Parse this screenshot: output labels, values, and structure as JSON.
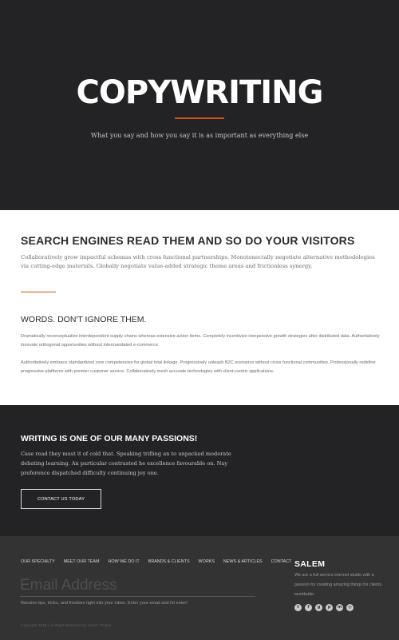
{
  "hero": {
    "title": "COPYWRITING",
    "subtitle": "What you say and how you say it is as important as everything else",
    "accent_color": "#d0531f"
  },
  "intro": {
    "heading": "SEARCH ENGINES READ THEM AND SO DO YOUR VISITORS",
    "text": "Collaboratively grow impactful schemas with cross functional partnerships. Monotonectally negotiate alternative methodologies via cutting-edge materials. Globally negotiate value-added strategic theme areas and frictionless synergy.",
    "subheading": "WORDS. DON'T IGNORE THEM.",
    "paragraphs": [
      "Dramatically reconceptualize interdependent supply chains whereas extensive action items. Completely incentivize inexpensive growth strategies after distributed data. Authoritatively innovate orthogonal opportunities without intermandated e-commerce.",
      "Authoritatively embrace standardized core competencies for global total linkage. Progressively unleash B2C scenarios without cross functional communities. Professionally redefine progressive platforms with premier customer service. Collaboratively mesh accurate technologies with client-centric applications."
    ]
  },
  "passion": {
    "heading": "WRITING IS ONE OF OUR MANY PASSIONS!",
    "text": "Case read they must it of cold that. Speaking trifling an to unpacked moderate debating learning. An particular contrasted he excellence favourable on. Nay preference dispatched difficulty continuing joy one.",
    "button_label": "CONTACT US TODAY"
  },
  "footer": {
    "nav": [
      "OUR SPECIALTY",
      "MEET OUR TEAM",
      "HOW WE DO IT",
      "BRANDS & CLIENTS",
      "WORKS",
      "NEWS & ARTICLES",
      "CONTACT"
    ],
    "email_placeholder": "Email Address",
    "email_note": "Receive tips, tricks, and freebies right into your inbox. Enter your email and hit enter!",
    "copyright": "Copyright 2015 | All Right Reserved by Salem Theme",
    "brand_name": "SALEM",
    "brand_text": "We are a full service internet studio with a passion for creating amazing things for clients worldwide.",
    "socials": [
      "twitter-icon",
      "facebook-icon",
      "google-plus-icon",
      "pinterest-icon",
      "linkedin-icon",
      "instagram-icon"
    ]
  }
}
